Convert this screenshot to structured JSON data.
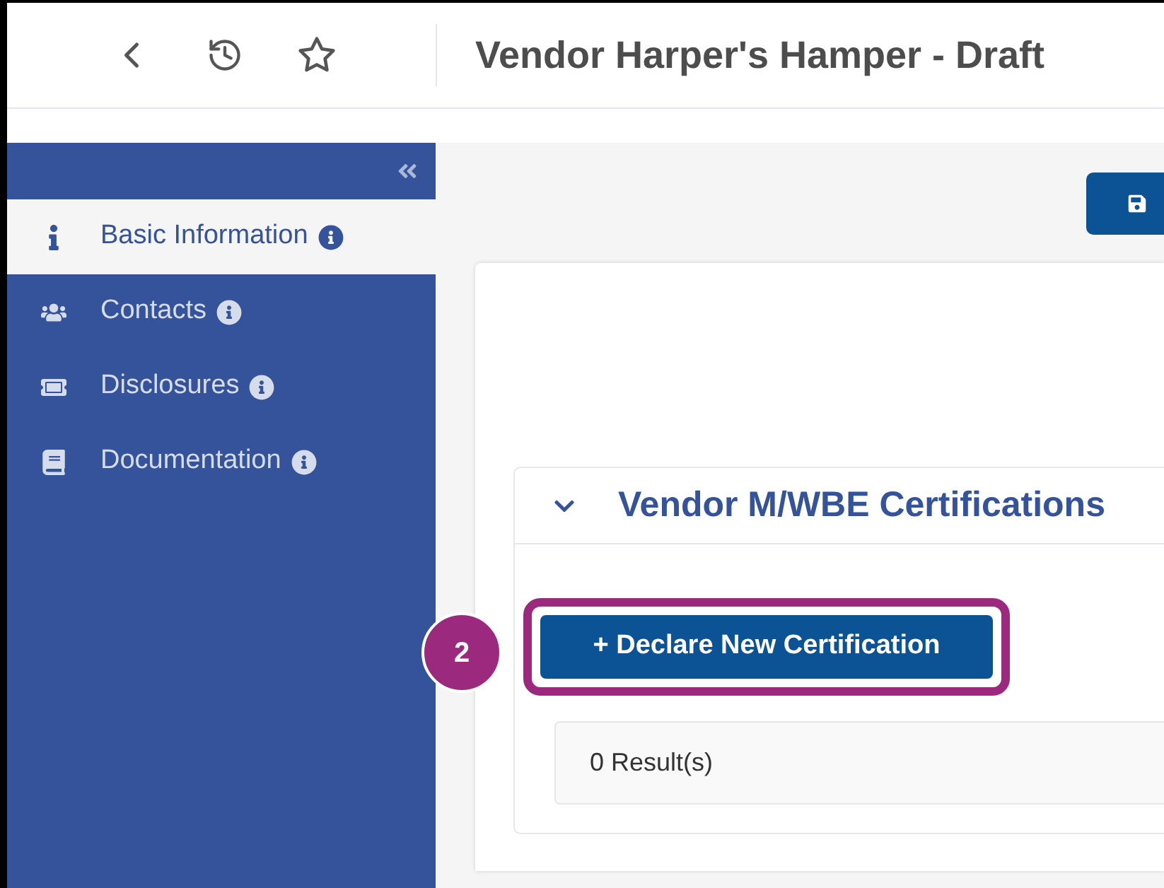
{
  "header": {
    "title": "Vendor Harper's Hamper - Draft"
  },
  "sidebar": {
    "items": [
      {
        "label": "Basic Information",
        "selected": true
      },
      {
        "label": "Contacts",
        "selected": false
      },
      {
        "label": "Disclosures",
        "selected": false
      },
      {
        "label": "Documentation",
        "selected": false
      }
    ]
  },
  "section": {
    "title": "Vendor M/WBE Certifications",
    "expanded": true,
    "button": "+ Declare New Certification",
    "results": "0 Result(s)"
  },
  "callout": {
    "label": "2"
  }
}
